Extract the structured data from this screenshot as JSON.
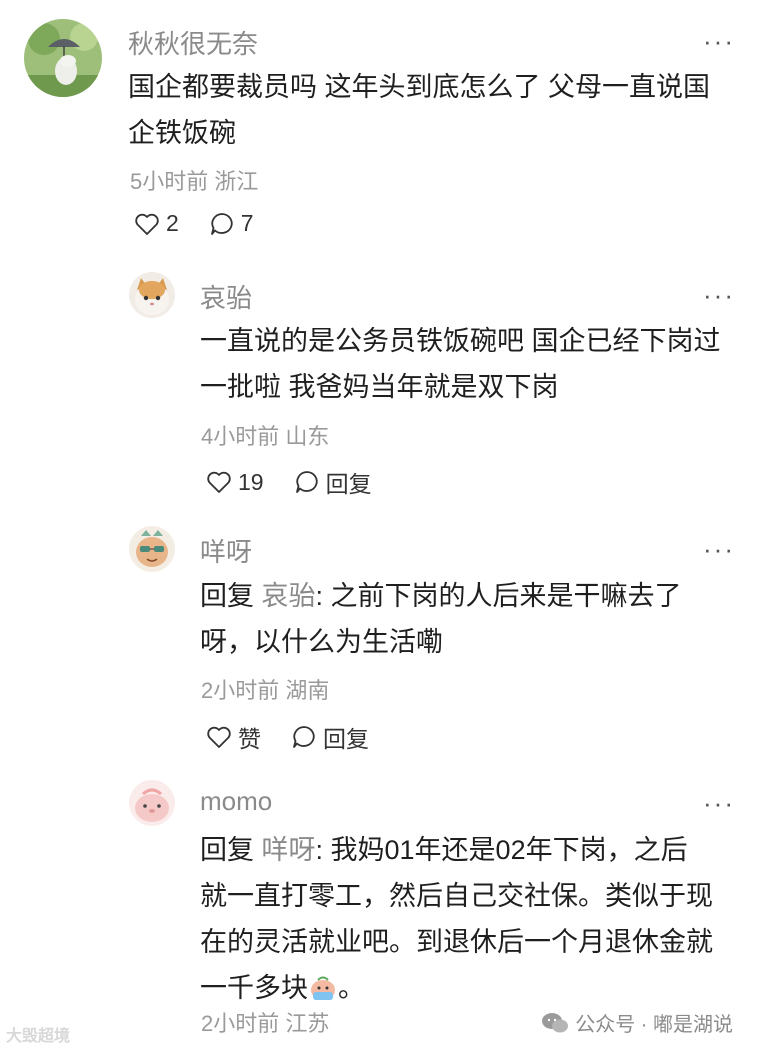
{
  "comments": [
    {
      "user": "秋秋很无奈",
      "text_lines": [
        "国企都要裁员吗 这年头到底怎么了 父母一直说国",
        "企铁饭碗"
      ],
      "time": "5小时前",
      "location": "浙江",
      "likes": "2",
      "replies": "7"
    },
    {
      "user": "哀骀",
      "text_lines": [
        "一直说的是公务员铁饭碗吧 国企已经下岗过",
        "一批啦 我爸妈当年就是双下岗"
      ],
      "time": "4小时前",
      "location": "山东",
      "likes": "19",
      "reply_label": "回复"
    },
    {
      "user": "咩呀",
      "reply_prefix": "回复",
      "reply_to": "哀骀",
      "text_first": ": 之前下岗的人后来是干嘛去了",
      "text_lines": [
        "呀，以什么为生活嘞"
      ],
      "time": "2小时前",
      "location": "湖南",
      "like_label": "赞",
      "reply_label": "回复"
    },
    {
      "user": "momo",
      "reply_prefix": "回复",
      "reply_to": "咩呀",
      "text_first": ": 我妈01年还是02年下岗，之后",
      "text_lines": [
        "就一直打零工，然后自己交社保。类似于现",
        "在的灵活就业吧。到退休后一个月退休金就",
        "一千多块"
      ],
      "text_end": "。",
      "time": "2小时前",
      "location": "江苏"
    }
  ],
  "more_label": "···",
  "watermark": {
    "left": "大毁超境",
    "right": "公众号 · 嘟是湖说"
  }
}
